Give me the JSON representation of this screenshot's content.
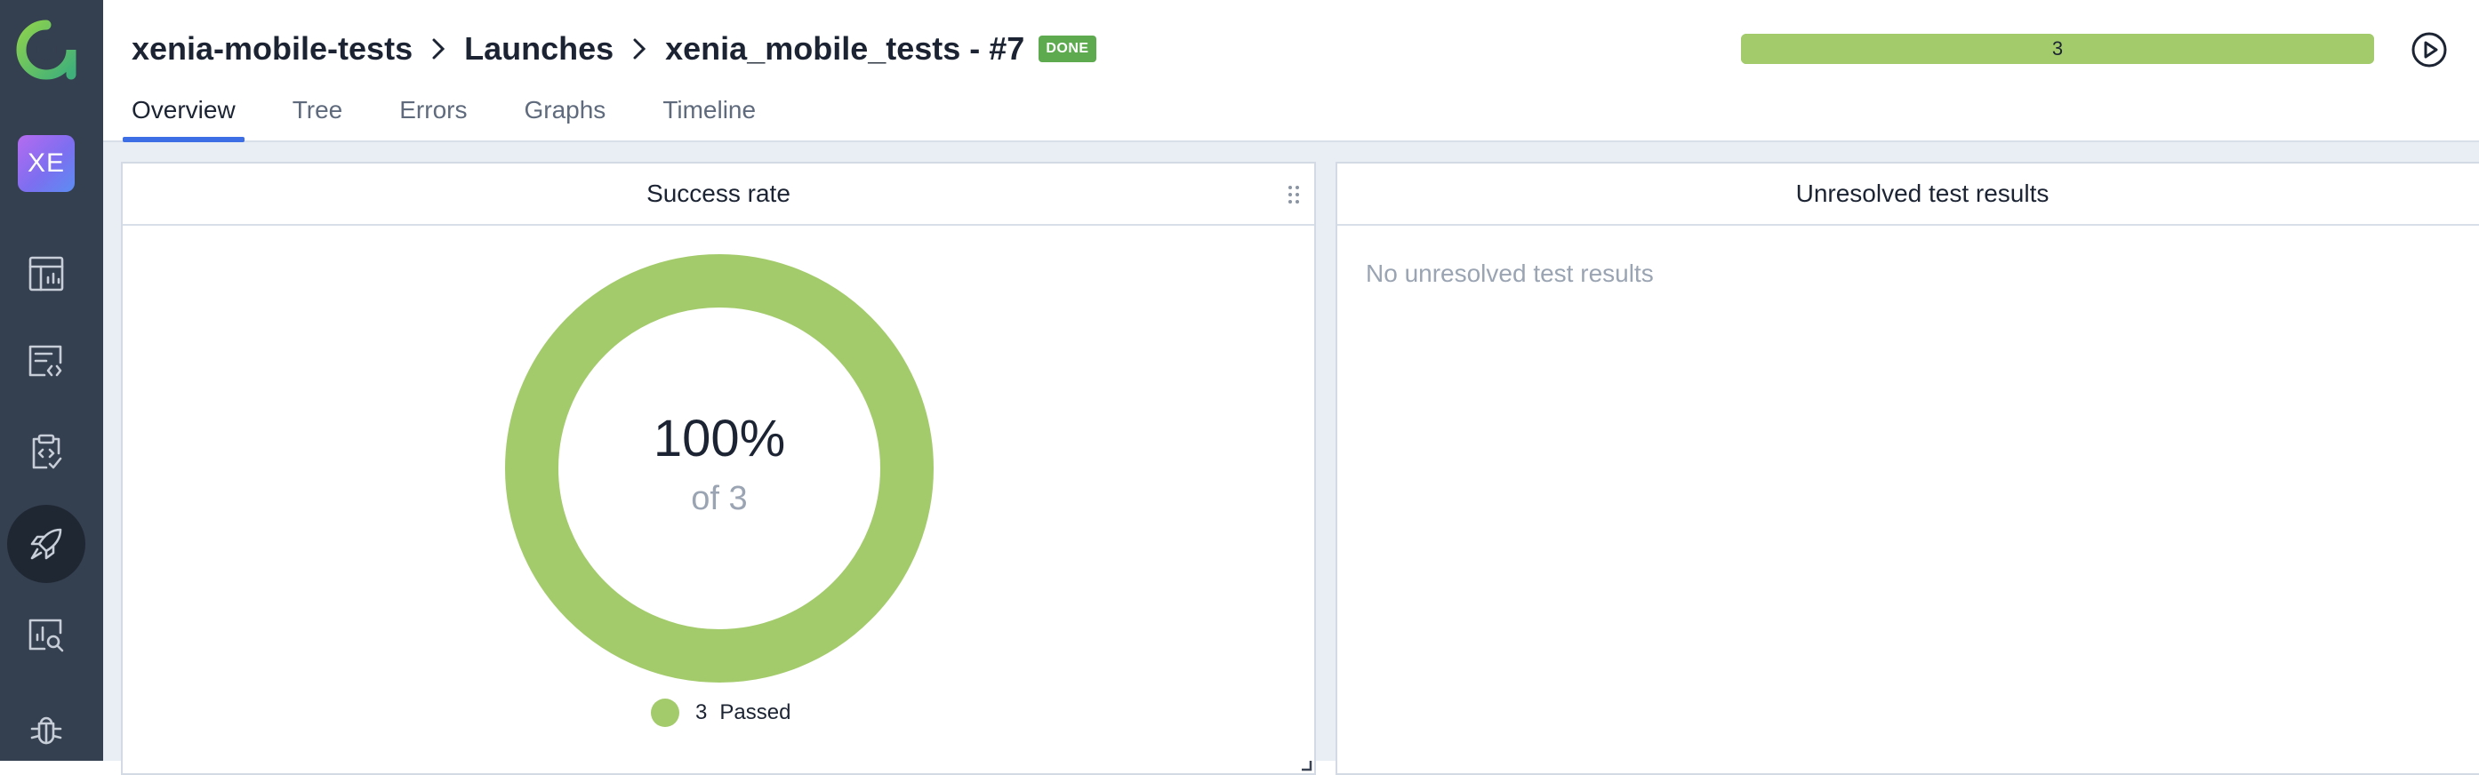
{
  "sidebar": {
    "project_initials": "XE",
    "items": [
      {
        "icon": "dashboard-icon"
      },
      {
        "icon": "test-cases-icon"
      },
      {
        "icon": "test-plans-icon"
      },
      {
        "icon": "launches-rocket-icon",
        "active": true
      },
      {
        "icon": "analytics-search-icon"
      },
      {
        "icon": "defects-bug-icon"
      }
    ]
  },
  "header": {
    "breadcrumb": [
      "xenia-mobile-tests",
      "Launches",
      "xenia_mobile_tests - #7"
    ],
    "status_badge": "DONE",
    "progress_label": "3",
    "progress_fraction": 1.0,
    "tabs": [
      "Overview",
      "Tree",
      "Errors",
      "Graphs",
      "Timeline"
    ],
    "active_tab": "Overview"
  },
  "widgets": {
    "success_rate": {
      "title": "Success rate",
      "percent_text": "100%",
      "of_text": "of 3",
      "legend": [
        {
          "count": "3",
          "label": "Passed",
          "color": "#a3cb6b"
        }
      ]
    },
    "unresolved": {
      "title": "Unresolved test results",
      "empty_text": "No unresolved test results"
    }
  },
  "colors": {
    "sidebar": "#343f4f",
    "accent": "#3e6ee6",
    "passed": "#a3cb6b",
    "done_badge": "#5daa4f",
    "logo": "#6cc04a"
  }
}
